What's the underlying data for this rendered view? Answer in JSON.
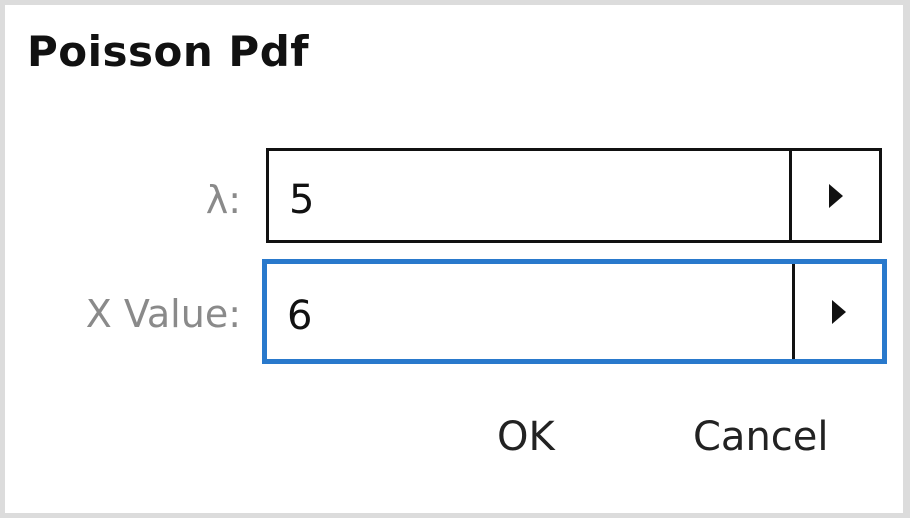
{
  "dialog": {
    "title": "Poisson Pdf",
    "fields": [
      {
        "label": "λ:",
        "value": "5"
      },
      {
        "label": "X Value:",
        "value": "6"
      }
    ],
    "buttons": {
      "ok": "OK",
      "cancel": "Cancel"
    },
    "colors": {
      "focus_border": "#2979cc",
      "label_text": "#8a8a8a",
      "frame": "#dcdcdc"
    },
    "icons": {
      "field_menu": "triangle-right-icon"
    }
  }
}
